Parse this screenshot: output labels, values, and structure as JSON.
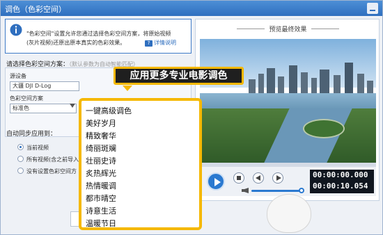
{
  "window": {
    "title": "调色（色彩空间）"
  },
  "info": {
    "line1": "\"色彩空间\"设置允许您通过选择色彩空间方案，将原始视频",
    "line2": "(灰片视频)还原出原本真实的色彩效果。",
    "help_label": "详情说明",
    "help_icon_text": "?"
  },
  "scheme": {
    "label": "请选择色彩空间方案：",
    "hint": "（默认参数为自动智能匹配）",
    "source_device_label": "源设备",
    "source_device_value": "大疆 DJI D-Log",
    "color_space_label": "色彩空间方案",
    "color_space_value": "标准色"
  },
  "sync": {
    "label": "自动同步应用到：",
    "options": [
      "当前视频",
      "所有视频(含之前导入",
      "没有设置色彩空间方"
    ]
  },
  "preview": {
    "title": "预览最终效果",
    "time_current": "00:00:00.000",
    "time_total": "00:00:10.054",
    "volume_level": 0.95
  },
  "callout": {
    "text": "应用更多专业电影调色"
  },
  "presets": [
    "一键高级调色",
    "美好岁月",
    "精致奢华",
    "绮丽斑斓",
    "壮丽史诗",
    "炙热辉光",
    "热情暖调",
    "都市晴空",
    "诗意生活",
    "温暖节日"
  ],
  "colors": {
    "accent": "#2a79d0",
    "highlight": "#f5b800",
    "titlebar": "#2f6fbf"
  }
}
